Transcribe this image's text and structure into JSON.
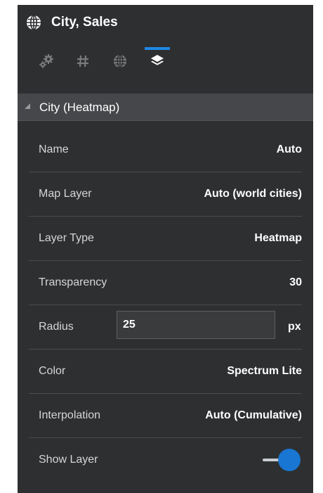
{
  "header": {
    "title": "City, Sales",
    "icon": "globe-icon"
  },
  "tabs": [
    {
      "icon": "gears-icon",
      "active": false
    },
    {
      "icon": "hash-icon",
      "active": false
    },
    {
      "icon": "globe-icon",
      "active": false
    },
    {
      "icon": "layers-icon",
      "active": true
    }
  ],
  "section": {
    "title": "City (Heatmap)",
    "expanded": true
  },
  "properties": {
    "name": {
      "label": "Name",
      "value": "Auto"
    },
    "map_layer": {
      "label": "Map Layer",
      "value": "Auto (world cities)"
    },
    "layer_type": {
      "label": "Layer Type",
      "value": "Heatmap"
    },
    "transparency": {
      "label": "Transparency",
      "value": "30"
    },
    "radius": {
      "label": "Radius",
      "value": "25",
      "unit": "px"
    },
    "color": {
      "label": "Color",
      "value": "Spectrum Lite"
    },
    "interpolation": {
      "label": "Interpolation",
      "value": "Auto (Cumulative)"
    },
    "show_layer": {
      "label": "Show Layer",
      "on": true
    }
  },
  "colors": {
    "panel_bg": "#2e2f31",
    "section_bg": "#45474a",
    "accent": "#1976d2",
    "tab_indicator": "#1e88e5"
  }
}
